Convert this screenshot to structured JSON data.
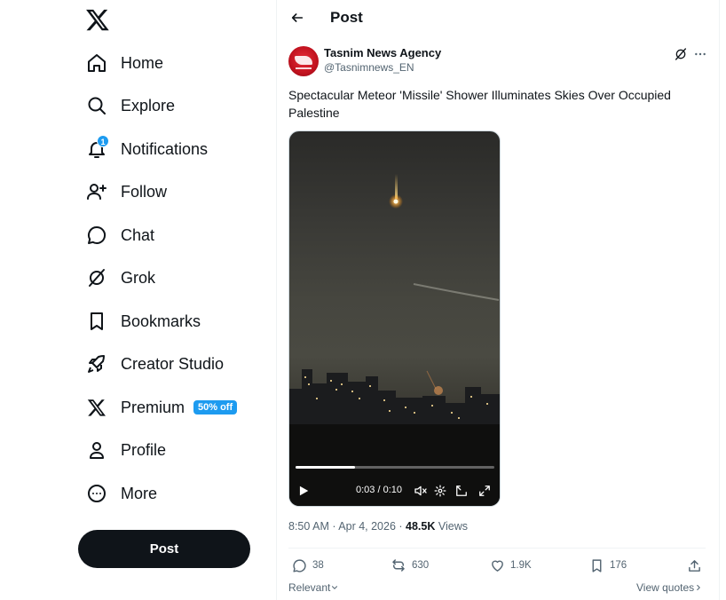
{
  "sidebar": {
    "items": [
      {
        "label": "Home",
        "icon": "home-icon"
      },
      {
        "label": "Explore",
        "icon": "search-icon"
      },
      {
        "label": "Notifications",
        "icon": "bell-icon",
        "badge": "1"
      },
      {
        "label": "Follow",
        "icon": "add-person-icon"
      },
      {
        "label": "Chat",
        "icon": "chat-bubble-icon"
      },
      {
        "label": "Grok",
        "icon": "grok-icon"
      },
      {
        "label": "Bookmarks",
        "icon": "bookmark-icon"
      },
      {
        "label": "Creator Studio",
        "icon": "rocket-icon"
      },
      {
        "label": "Premium",
        "icon": "x-logo-icon",
        "promo": "50% off"
      },
      {
        "label": "Profile",
        "icon": "person-icon"
      },
      {
        "label": "More",
        "icon": "more-circle-icon"
      }
    ],
    "post_button": "Post"
  },
  "header": {
    "title": "Post"
  },
  "tweet": {
    "author_name": "Tasnim News Agency",
    "author_handle": "@Tasnimnews_EN",
    "text": "Spectacular Meteor 'Missile' Shower Illuminates Skies Over Occupied Palestine",
    "video": {
      "time": "0:03 / 0:10",
      "progress": 0.3
    },
    "timestamp": "8:50 AM · Apr 4, 2026 · ",
    "views_count": "48.5K",
    "views_label": " Views",
    "stats": {
      "replies": "38",
      "reposts": "630",
      "likes": "1.9K",
      "bookmarks": "176"
    },
    "sort_label": "Relevant",
    "quotes_label": "View quotes"
  },
  "colors": {
    "accent": "#1d9bf0",
    "text": "#0f1419",
    "muted": "#536471"
  }
}
